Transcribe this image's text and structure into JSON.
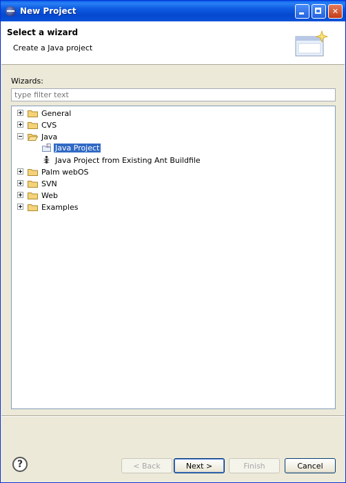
{
  "window": {
    "title": "New Project"
  },
  "header": {
    "title": "Select a wizard",
    "description": "Create a Java project"
  },
  "wizards_label": "Wizards:",
  "filter": {
    "placeholder": "type filter text",
    "value": ""
  },
  "tree": {
    "items": [
      {
        "label": "General",
        "expanded": false,
        "icon": "folder-icon"
      },
      {
        "label": "CVS",
        "expanded": false,
        "icon": "folder-icon"
      },
      {
        "label": "Java",
        "expanded": true,
        "icon": "folder-open-icon"
      },
      {
        "label": "Java Project",
        "selected": true,
        "icon": "java-project-icon"
      },
      {
        "label": "Java Project from Existing Ant Buildfile",
        "icon": "ant-icon"
      },
      {
        "label": "Palm webOS",
        "expanded": false,
        "icon": "folder-icon"
      },
      {
        "label": "SVN",
        "expanded": false,
        "icon": "folder-icon"
      },
      {
        "label": "Web",
        "expanded": false,
        "icon": "folder-icon"
      },
      {
        "label": "Examples",
        "expanded": false,
        "icon": "folder-icon"
      }
    ]
  },
  "buttons": {
    "back": "< Back",
    "next": "Next >",
    "finish": "Finish",
    "cancel": "Cancel",
    "help": "?"
  },
  "colors": {
    "titlebar": "#0a53d8",
    "selection": "#316ac5",
    "dialog_bg": "#ece9d8"
  }
}
